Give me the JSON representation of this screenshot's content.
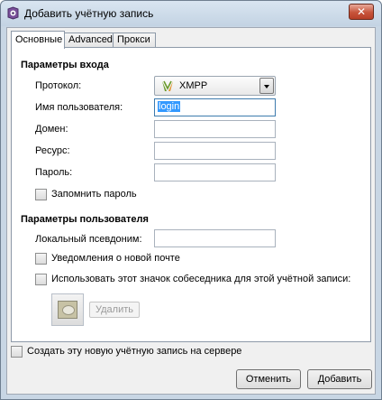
{
  "window": {
    "title": "Добавить учётную запись",
    "close_label": "✕"
  },
  "tabs": [
    {
      "label": "Основные",
      "active": true
    },
    {
      "label": "Advanced",
      "active": false
    },
    {
      "label": "Прокси",
      "active": false
    }
  ],
  "login_section": {
    "title": "Параметры входа",
    "protocol_label": "Протокол:",
    "protocol_value": "XMPP",
    "username_label": "Имя пользователя:",
    "username_value": "login",
    "domain_label": "Домен:",
    "domain_value": "",
    "resource_label": "Ресурс:",
    "resource_value": "",
    "password_label": "Пароль:",
    "password_value": "",
    "remember_password_label": "Запомнить пароль",
    "remember_password_checked": false
  },
  "user_section": {
    "title": "Параметры пользователя",
    "alias_label": "Локальный псевдоним:",
    "alias_value": "",
    "new_mail_label": "Уведомления о новой почте",
    "new_mail_checked": false,
    "buddy_icon_label": "Использовать этот значок собеседника для этой учётной записи:",
    "buddy_icon_checked": false,
    "remove_label": "Удалить"
  },
  "footer": {
    "create_on_server_label": "Создать эту новую учётную запись на сервере",
    "create_on_server_checked": false,
    "cancel_label": "Отменить",
    "add_label": "Добавить"
  },
  "colors": {
    "selection": "#3399ff",
    "xmpp_logo_green": "#6a9a2a",
    "xmpp_logo_orange": "#e0902a"
  }
}
